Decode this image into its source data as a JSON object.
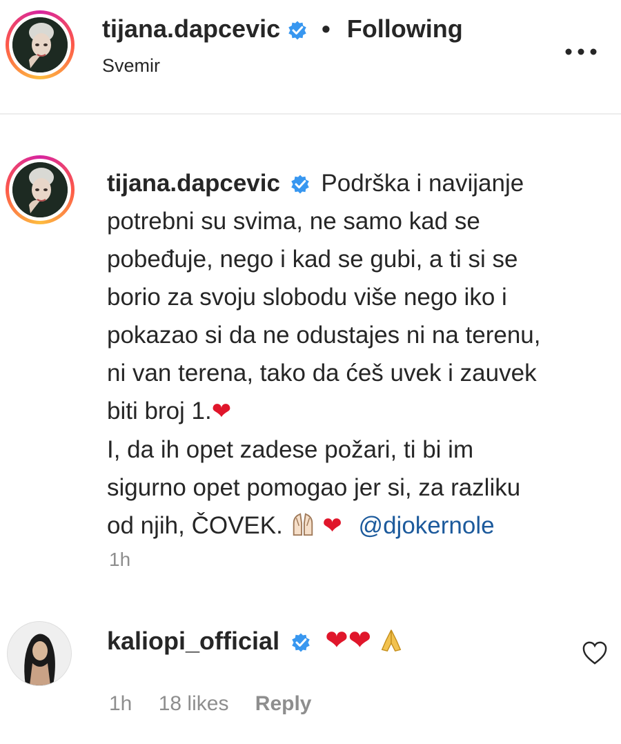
{
  "header": {
    "username": "tijana.dapcevic",
    "separator": "•",
    "follow_status": "Following",
    "location": "Svemir",
    "more_label": "..."
  },
  "caption": {
    "username": "tijana.dapcevic",
    "lines": [
      "Podrška i navijanje",
      "potrebni su svima, ne samo kad se",
      "pobeđuje, nego i kad se gubi, a ti si se",
      "borio za svoju slobodu više nego iko i",
      "pokazao si da ne odustajes ni na terenu,",
      "ni van terena, tako da ćeš uvek i zauvek",
      "biti broj 1.",
      "I, da ih opet zadese požari, ti bi im",
      "sigurno opet pomogao jer si, za razliku",
      "od njih, ČOVEK."
    ],
    "heart1": "❤",
    "heart2": "❤",
    "mention": "@djokernole",
    "time": "1h"
  },
  "comment": {
    "username": "kaliopi_official",
    "heart1": "❤",
    "heart2": "❤",
    "time": "1h",
    "likes": "18 likes",
    "reply": "Reply"
  },
  "icons": {
    "verified": "verified-badge-icon",
    "more": "more-options-icon",
    "like": "heart-outline-icon",
    "hands": "raised-hands-icon",
    "pray": "folded-hands-icon"
  },
  "colors": {
    "verified": "#3897f0",
    "heart": "#e0162b",
    "mention": "#1c5a9c",
    "muted": "#8e8e8e"
  }
}
